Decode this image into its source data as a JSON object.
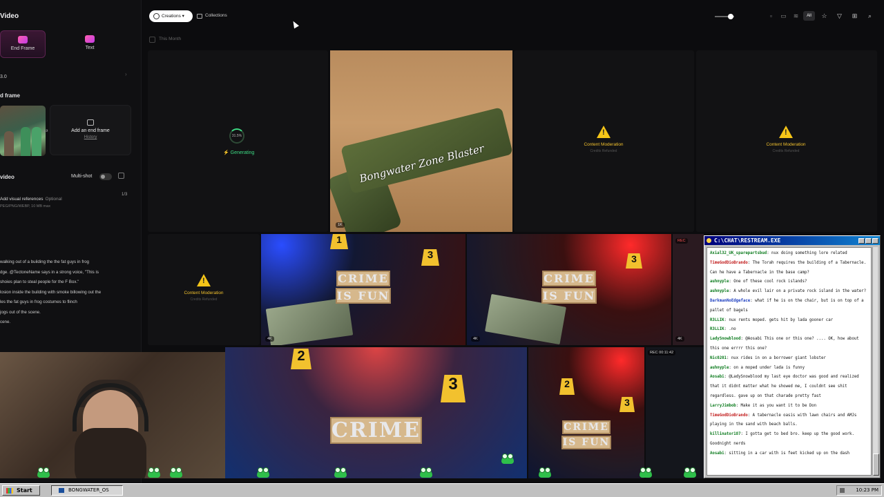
{
  "left_panel": {
    "title": "Video",
    "tabs": [
      {
        "label": "End Frame"
      },
      {
        "label": "Text"
      }
    ],
    "model_value": "3.0",
    "end_frame_section": "d frame",
    "add_end_frame": {
      "label": "Add an end frame",
      "sub": "History"
    },
    "video_section": "video",
    "multishot_label": "Multi-shot",
    "visual_refs": {
      "label": "Add visual references",
      "optional": "Optional",
      "formats": "PEG/PNG/WEBP, 10 MB max",
      "count": "1/3"
    },
    "prompt_lines": [
      "walking out of a building the the fat guys in frog",
      "dge. @TectoneName says in a strong voice, \"This is",
      "shoies plan to steal people for the F Box.\"",
      "losion inside the building with smoke billowing out the",
      "les the fat guys in frog costumes to flinch",
      "jogs out of the scene.",
      "cene."
    ]
  },
  "topbar": {
    "creations_label": "Creations",
    "collections_label": "Collections",
    "all_label": "All"
  },
  "filter": {
    "this_month": "This Month"
  },
  "grid": {
    "generating": {
      "percent": "31.5%",
      "label": "Generating"
    },
    "moderation": {
      "title": "Content Moderation",
      "sub": "Credits Refunded"
    },
    "gun_text": "Bongwater Zone Blaster",
    "badges": {
      "gun": "1K",
      "crime": "4K"
    },
    "crime_words": [
      "CRIME",
      "IS FUN"
    ],
    "rec_label": "REC",
    "rec_time": "REC 00:11:42"
  },
  "chat": {
    "title": "C:\\CHAT\\RESTREAM.EXE",
    "messages": [
      {
        "user": "Axial32_UK_sparepartsbud",
        "color": "g",
        "text": "nux doing something lore related"
      },
      {
        "user": "TimeGodDioBrando",
        "color": "r",
        "text": "The Torah requires the building of a Tabernacle. Can he have a Tabernacle in the base camp?"
      },
      {
        "user": "auhnyple",
        "color": "g",
        "text": "One of these cool rock islands?"
      },
      {
        "user": "auhnyple",
        "color": "g",
        "text": "A whole evil lair on a private rock island in the water?"
      },
      {
        "user": "DarkmanNoEdgeface",
        "color": "b",
        "text": "what if he is on the chair, but is on top of a pallet of bagels"
      },
      {
        "user": "R3LLIK",
        "color": "g",
        "text": "nux rents moped. gets hit by lada gooner car"
      },
      {
        "user": "R3LLIK",
        "color": "g",
        "text": ".no"
      },
      {
        "user": "LadySnowblood",
        "color": "g",
        "text": "@Aosabi This one or this one? .... OK, how about this one errrr this one?"
      },
      {
        "user": "Nic0201",
        "color": "g",
        "text": "nux rides in on a borrower giant lobster"
      },
      {
        "user": "auhnyple",
        "color": "g",
        "text": "on a moped under lada is funny"
      },
      {
        "user": "Aosabi",
        "color": "g",
        "text": "@LadySnowblood my last eye doctor was good and realized that it didnt matter what he showed me, I couldnt see shit regardless. gave up on that charade pretty fast"
      },
      {
        "user": "LarryJimbob",
        "color": "g",
        "text": "Make it as you want it to be Don"
      },
      {
        "user": "TimeGodDioBrando",
        "color": "r",
        "text": "A tabernacle oasis with lawn chairs and AMJs playing in the sand with beach balls."
      },
      {
        "user": "killinator187",
        "color": "g",
        "text": "I gotta get to bed bro. keep up the good work. Goodnight nerds"
      },
      {
        "user": "Aosabi",
        "color": "g",
        "text": "sitting in a car with is feet kicked up on the dash"
      }
    ]
  },
  "taskbar": {
    "start_label": "Start",
    "task_label": "BONGWATER_OS",
    "clock": "10:23 PM"
  },
  "colors": {
    "accent_green": "#3ddc84",
    "warning_yellow": "#f5c518",
    "brand_pink": "#ff5fae"
  }
}
